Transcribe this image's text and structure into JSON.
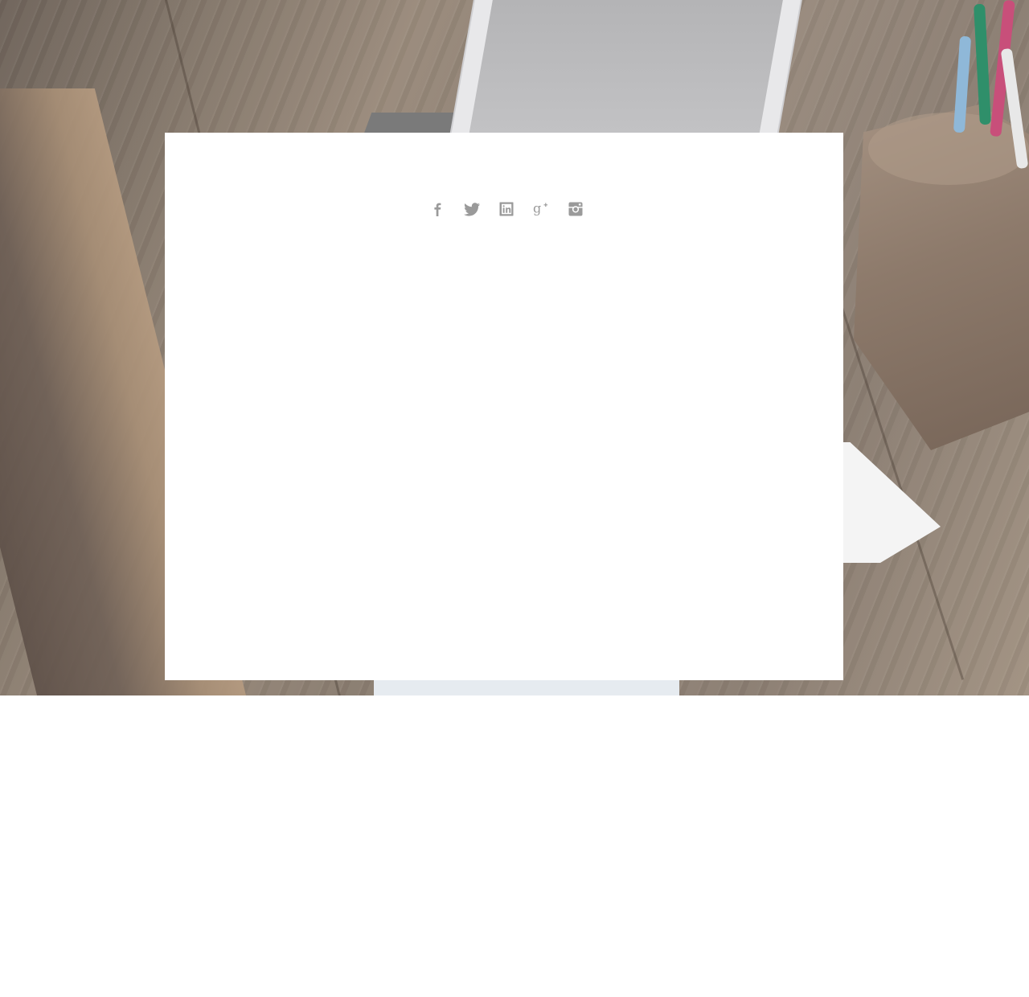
{
  "page": {
    "background_color": "#ffffff",
    "panel_color": "#ffffff",
    "icon_color": "#9a9a9a"
  },
  "hero": {
    "image": "desk-workspace-photo",
    "scene": [
      "laptop",
      "wooden-pen-holder",
      "wooden-desk",
      "paper-sheet"
    ]
  },
  "social_links": [
    {
      "icon": "facebook-icon"
    },
    {
      "icon": "twitter-icon"
    },
    {
      "icon": "linkedin-icon"
    },
    {
      "icon": "google-plus-icon"
    },
    {
      "icon": "instagram-icon"
    }
  ]
}
